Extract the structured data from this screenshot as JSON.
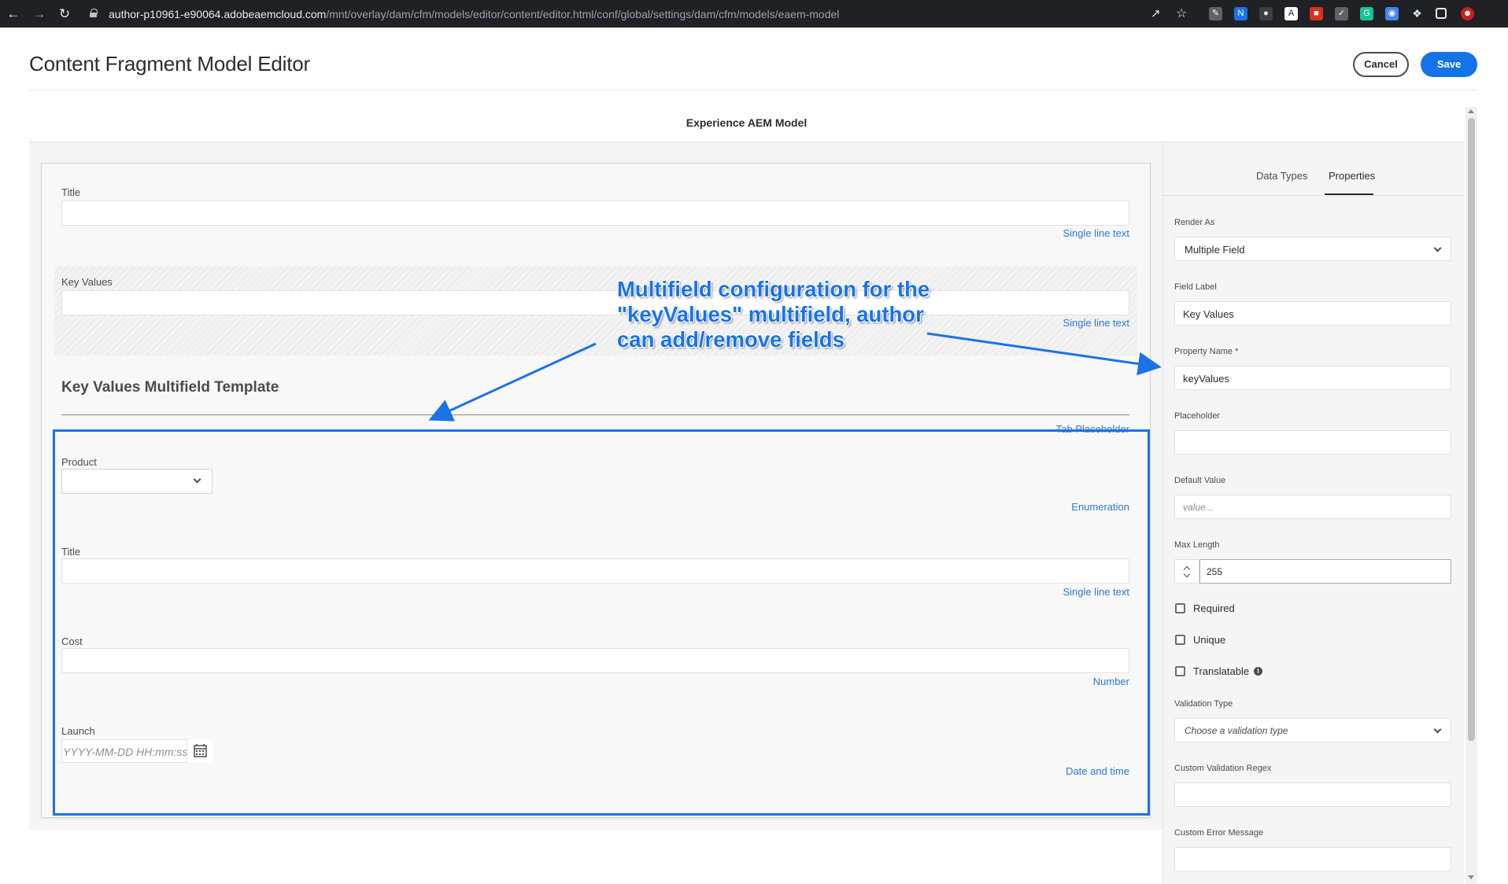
{
  "browser": {
    "url_host": "author-p10961-e90064.adobeaemcloud.com",
    "url_path": "/mnt/overlay/dam/cfm/models/editor/content/editor.html/conf/global/settings/dam/cfm/models/eaem-model"
  },
  "header": {
    "title": "Content Fragment Model Editor",
    "cancel_label": "Cancel",
    "save_label": "Save",
    "model_name": "Experience AEM Model"
  },
  "form": {
    "title_field": {
      "label": "Title",
      "type": "Single line text"
    },
    "key_values_field": {
      "label": "Key Values",
      "type": "Single line text"
    },
    "template_heading": "Key Values Multifield Template",
    "tab_placeholder": "Tab Placeholder",
    "template_fields": {
      "product": {
        "label": "Product",
        "type": "Enumeration"
      },
      "title": {
        "label": "Title",
        "type": "Single line text"
      },
      "cost": {
        "label": "Cost",
        "type": "Number"
      },
      "launch": {
        "label": "Launch",
        "placeholder": "YYYY-MM-DD HH:mm:ss",
        "type": "Date and time"
      }
    }
  },
  "annotation": {
    "text": "Multifield configuration for the \"keyValues\" multifield, author can add/remove fields",
    "color": "#1a73e8"
  },
  "properties_panel": {
    "tabs": [
      "Data Types",
      "Properties"
    ],
    "active_tab": "Properties",
    "render_as": {
      "label": "Render As",
      "value": "Multiple Field"
    },
    "field_label": {
      "label": "Field Label",
      "value": "Key Values"
    },
    "property_name": {
      "label": "Property Name *",
      "value": "keyValues"
    },
    "placeholder": {
      "label": "Placeholder",
      "value": ""
    },
    "default_value": {
      "label": "Default Value",
      "placeholder": "value..."
    },
    "max_length": {
      "label": "Max Length",
      "value": "255"
    },
    "checkboxes": [
      {
        "label": "Required",
        "checked": false
      },
      {
        "label": "Unique",
        "checked": false
      },
      {
        "label": "Translatable",
        "checked": false
      }
    ],
    "validation_type": {
      "label": "Validation Type",
      "placeholder": "Choose a validation type"
    },
    "custom_validation_regex": {
      "label": "Custom Validation Regex",
      "value": ""
    },
    "custom_error_message": {
      "label": "Custom Error Message",
      "value": ""
    }
  },
  "colors": {
    "accent": "#1473e6",
    "link": "#2d78d4"
  }
}
